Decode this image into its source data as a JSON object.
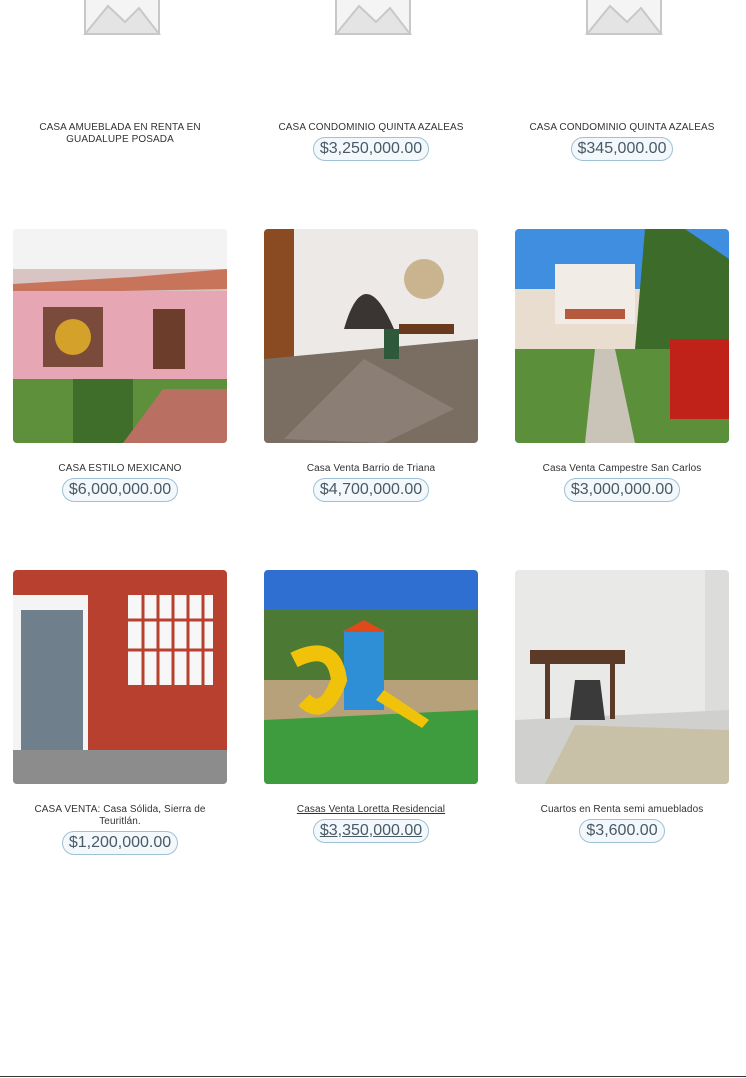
{
  "listings": [
    {
      "title": "CASA AMUEBLADA EN RENTA EN GUADALUPE POSADA",
      "price": "",
      "image": "placeholder-image"
    },
    {
      "title": "CASA CONDOMINIO QUINTA AZALEAS",
      "price": "$3,250,000.00",
      "image": "placeholder-image"
    },
    {
      "title": "CASA CONDOMINIO QUINTA AZALEAS",
      "price": "$345,000.00",
      "image": "placeholder-image"
    },
    {
      "title": "CASA ESTILO MEXICANO",
      "price": "$6,000,000.00",
      "image": "house-photo"
    },
    {
      "title": "Casa Venta Barrio de Triana",
      "price": "$4,700,000.00",
      "image": "interior-photo"
    },
    {
      "title": "Casa Venta Campestre San Carlos",
      "price": "$3,000,000.00",
      "image": "house-garden-photo"
    },
    {
      "title": "CASA VENTA: Casa Sólida, Sierra de Teuritlán.",
      "price": "$1,200,000.00",
      "image": "facade-photo"
    },
    {
      "title": "Casas Venta Loretta Residencial",
      "price": "$3,350,000.00",
      "image": "playground-photo"
    },
    {
      "title": "Cuartos en Renta semi amueblados",
      "price": "$3,600.00",
      "image": "room-photo"
    }
  ]
}
